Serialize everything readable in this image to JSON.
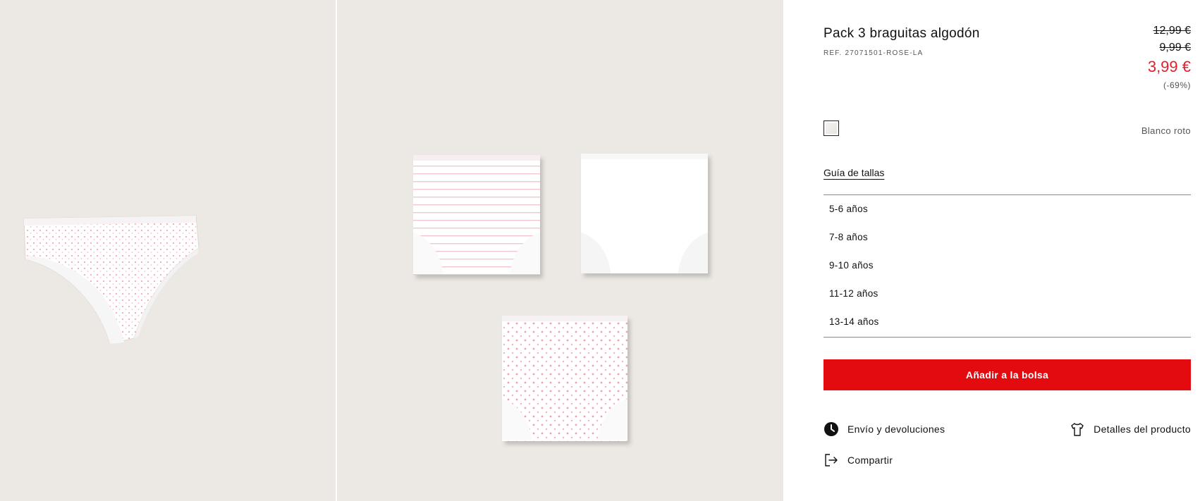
{
  "product": {
    "title": "Pack 3 braguitas algodón",
    "ref": "REF. 27071501-ROSE-LA",
    "price_old_1": "12,99 €",
    "price_old_2": "9,99 €",
    "price_now": "3,99 €",
    "discount": "(-69%)",
    "color_name": "Blanco roto"
  },
  "size_guide_label": "Guía de tallas",
  "sizes": [
    "5-6 años",
    "7-8 años",
    "9-10 años",
    "11-12 años",
    "13-14 años"
  ],
  "add_to_bag_label": "Añadir a la bolsa",
  "links": {
    "shipping": "Envío y devoluciones",
    "details": "Detalles del producto",
    "share": "Compartir"
  },
  "icons": {
    "shipping": "clock-icon",
    "details": "tshirt-icon",
    "share": "share-icon"
  },
  "colors": {
    "accent_red": "#e40b10",
    "sale_price": "#e2202c",
    "gallery_bg": "#ece8e3"
  }
}
